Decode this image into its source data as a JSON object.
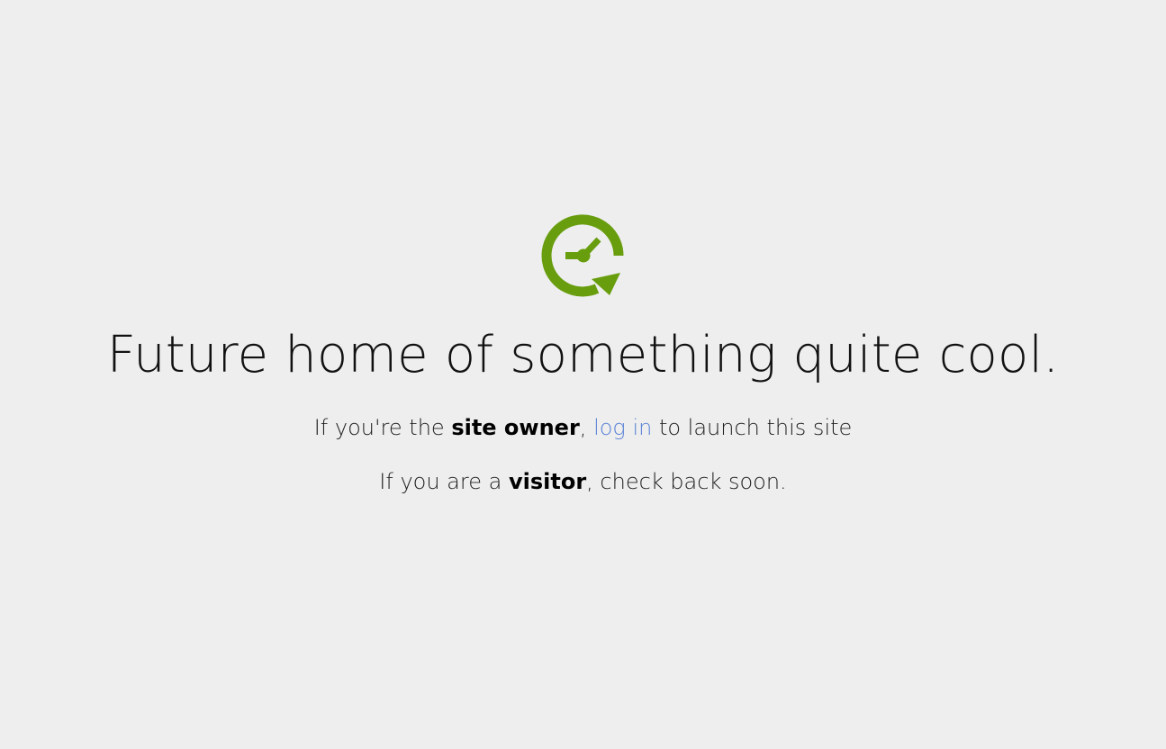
{
  "brand": {
    "accent_color": "#689d0d",
    "logo_icon": "clock-refresh-icon"
  },
  "headline": "Future home of something quite cool.",
  "owner_line": {
    "prefix": "If you're the ",
    "bold": "site owner",
    "comma": ", ",
    "link": "log in",
    "suffix": " to launch this site"
  },
  "visitor_line": {
    "prefix": "If you are a ",
    "bold": "visitor",
    "suffix": ", check back soon."
  }
}
